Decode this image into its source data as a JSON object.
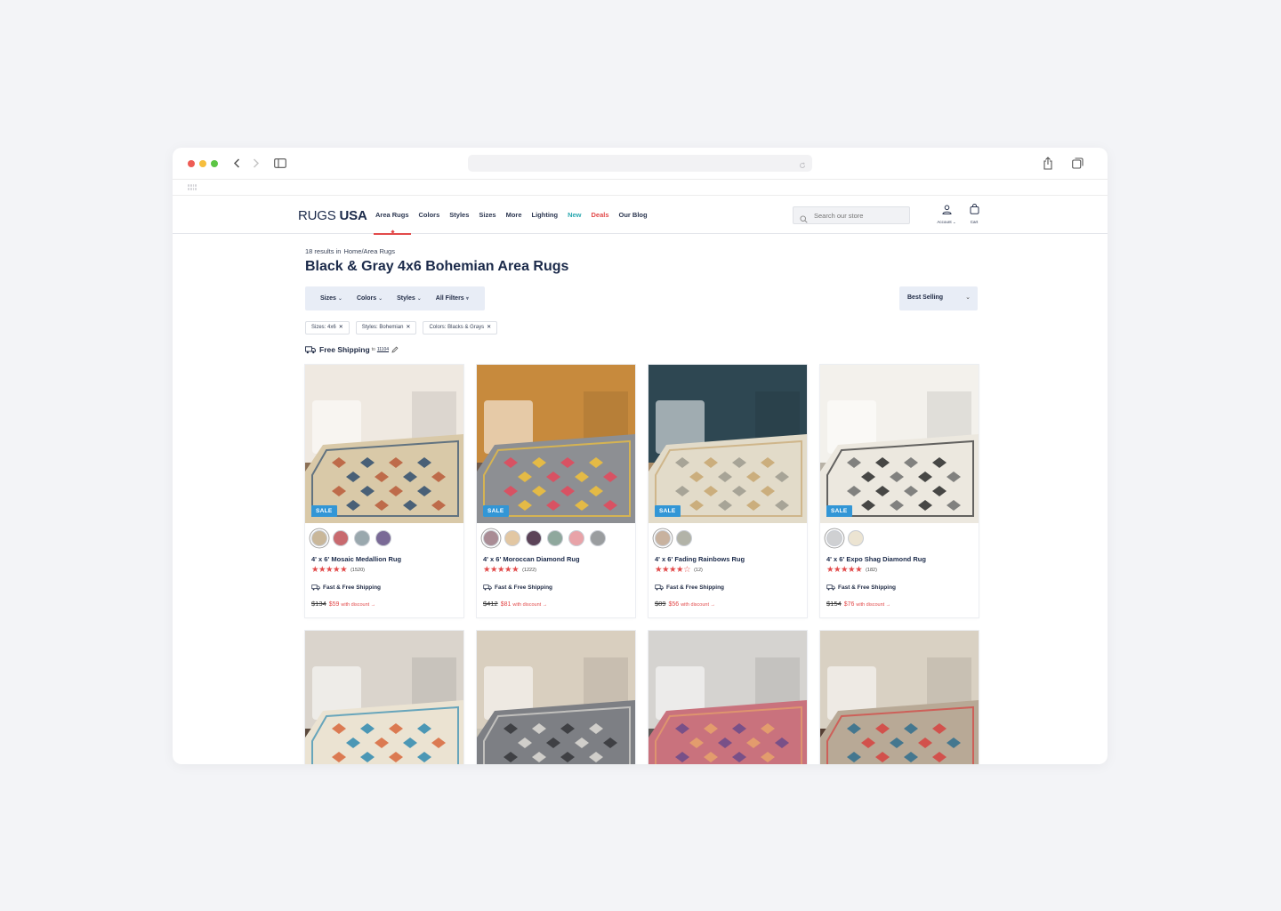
{
  "browser": {
    "colors": {
      "close": "#ee5c55",
      "minimize": "#f6be3d",
      "maximize": "#5cc544"
    }
  },
  "header": {
    "logo_light": "RUGS",
    "logo_bold": "USA",
    "nav": [
      {
        "label": "Area Rugs",
        "key": "area-rugs",
        "style": "active"
      },
      {
        "label": "Colors",
        "key": "colors",
        "style": ""
      },
      {
        "label": "Styles",
        "key": "styles",
        "style": ""
      },
      {
        "label": "Sizes",
        "key": "sizes",
        "style": ""
      },
      {
        "label": "More",
        "key": "more",
        "style": ""
      },
      {
        "label": "Lighting",
        "key": "lighting",
        "style": ""
      },
      {
        "label": "New",
        "key": "new",
        "style": "new"
      },
      {
        "label": "Deals",
        "key": "deals",
        "style": "deals"
      },
      {
        "label": "Our Blog",
        "key": "our-blog",
        "style": ""
      }
    ],
    "search_placeholder": "Search our store",
    "account_label": "Account",
    "cart_label": "Cart"
  },
  "page": {
    "results": "18 results in",
    "breadcrumb": "Home/Area Rugs",
    "title": "Black & Gray 4x6 Bohemian Area Rugs",
    "filters": [
      "Sizes",
      "Colors",
      "Styles"
    ],
    "all_filters": "All Filters",
    "sort": "Best Selling",
    "chips": [
      "Sizes: 4x6",
      "Styles: Bohemian",
      "Colors: Blacks & Grays"
    ],
    "shipping": {
      "label": "Free Shipping",
      "to": "to",
      "zip": "11104"
    }
  },
  "products": [
    {
      "name": "4' x 6' Mosaic Medallion Rug",
      "reviews": "(1520)",
      "rating": 5,
      "shipping": "Fast & Free Shipping",
      "old_price": "$134",
      "new_price": "$59",
      "discount_text": "with discount",
      "badge": "SALE",
      "swatches": [
        "#c9b79a",
        "#c86a6f",
        "#9aa8ae",
        "#7a6a96"
      ],
      "rug": {
        "base": "#d9c9a8",
        "accent": "#2f4e6f",
        "accent2": "#b85a3a",
        "floor": "#8a6f55",
        "wall": "#efe9e1"
      }
    },
    {
      "name": "4' x 6' Moroccan Diamond Rug",
      "reviews": "(1222)",
      "rating": 5,
      "shipping": "Fast & Free Shipping",
      "old_price": "$412",
      "new_price": "$81",
      "discount_text": "with discount",
      "badge": "SALE",
      "swatches": [
        "#a98c95",
        "#e2c7a3",
        "#5b4358",
        "#8fa89d",
        "#e8a3a8",
        "#9a9d9f"
      ],
      "rug": {
        "base": "#8d8f93",
        "accent": "#f3c238",
        "accent2": "#e5485a",
        "floor": "#6e5a4c",
        "wall": "#c78a3d"
      }
    },
    {
      "name": "4' x 6' Fading Rainbows Rug",
      "reviews": "(12)",
      "rating": 4,
      "shipping": "Fast & Free Shipping",
      "old_price": "$89",
      "new_price": "$56",
      "discount_text": "with discount",
      "badge": "SALE",
      "swatches": [
        "#c8b29f",
        "#b2b3a8"
      ],
      "rug": {
        "base": "#e2dbc9",
        "accent": "#c7a670",
        "accent2": "#9c9a8e",
        "floor": "#a98b66",
        "wall": "#2e4752"
      }
    },
    {
      "name": "4' x 6' Expo Shag Diamond Rug",
      "reviews": "(182)",
      "rating": 5,
      "shipping": "Fast & Free Shipping",
      "old_price": "$154",
      "new_price": "$76",
      "discount_text": "with discount",
      "badge": "SALE",
      "swatches": [
        "#cfd0d2",
        "#ece4d2"
      ],
      "rug": {
        "base": "#ece8df",
        "accent": "#2a2a2a",
        "accent2": "#6f6f6f",
        "floor": "#b8b2a6",
        "wall": "#f3f1ec"
      }
    },
    {
      "rug": {
        "base": "#ebe3d2",
        "accent": "#2f8ab0",
        "accent2": "#d8673c",
        "floor": "#5b4a3d",
        "wall": "#dad4cc"
      }
    },
    {
      "rug": {
        "base": "#7d7f84",
        "accent": "#dedcd6",
        "accent2": "#343538",
        "floor": "#c8c2b4",
        "wall": "#d9cfbf"
      }
    },
    {
      "rug": {
        "base": "#c9727d",
        "accent": "#e7a36a",
        "accent2": "#6a4a8a",
        "floor": "#5d5957",
        "wall": "#d5d3d0"
      }
    },
    {
      "rug": {
        "base": "#b8a996",
        "accent": "#d6423f",
        "accent2": "#2f6f8e",
        "floor": "#553f33",
        "wall": "#d9d1c3"
      }
    }
  ]
}
